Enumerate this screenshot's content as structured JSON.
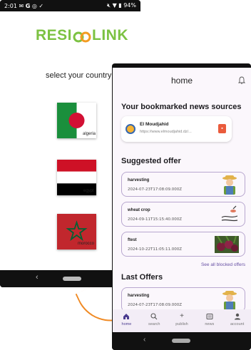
{
  "colors": {
    "brand_green": "#7cc242",
    "brand_orange": "#f39c22",
    "accent_purple": "#6750a4",
    "cable_orange": "#f08a24"
  },
  "phone1": {
    "status": {
      "time": "2:01",
      "battery": "94%",
      "icons": [
        "mail-icon",
        "google-icon",
        "instagram-icon",
        "check-icon",
        "mute-icon",
        "wifi-icon",
        "battery-icon"
      ]
    },
    "logo": {
      "left": "RESI",
      "right": "LINK"
    },
    "title": "select your country",
    "countries": [
      {
        "name": "algeria"
      },
      {
        "name": "egypt"
      },
      {
        "name": "morocco"
      }
    ]
  },
  "phone2": {
    "appbar": {
      "title": "home",
      "icon": "bell-icon"
    },
    "bookmarks": {
      "title": "Your bookmarked news sources",
      "items": [
        {
          "name": "El Moudjahid",
          "url": "https://www.elmoudjahid.dz/...",
          "icon": "globe-icon",
          "action_icon": "trash-icon"
        }
      ]
    },
    "suggested": {
      "title": "Suggested offer",
      "items": [
        {
          "title": "harvesting",
          "date": "2024-07-23T17:08:09.000Z",
          "image": "farmer-icon"
        },
        {
          "title": "wheat crop",
          "date": "2024-09-11T15:15:40.000Z",
          "image": "hand-wheat-icon"
        },
        {
          "title": "ftest",
          "date": "2024-10-22T11:05:11.000Z",
          "image": "beets-photo"
        }
      ],
      "see_all": "See all blocked offers"
    },
    "last_offers": {
      "title": "Last Offers",
      "items": [
        {
          "title": "harvesting",
          "date": "2024-07-23T17:08:09.000Z",
          "image": "farmer-icon"
        }
      ]
    },
    "bottom_nav": [
      {
        "label": "home",
        "icon": "home-icon",
        "active": true
      },
      {
        "label": "search",
        "icon": "search-icon",
        "active": false
      },
      {
        "label": "publish",
        "icon": "plus-icon",
        "active": false
      },
      {
        "label": "news",
        "icon": "news-icon",
        "active": false
      },
      {
        "label": "account",
        "icon": "account-icon",
        "active": false
      }
    ]
  }
}
